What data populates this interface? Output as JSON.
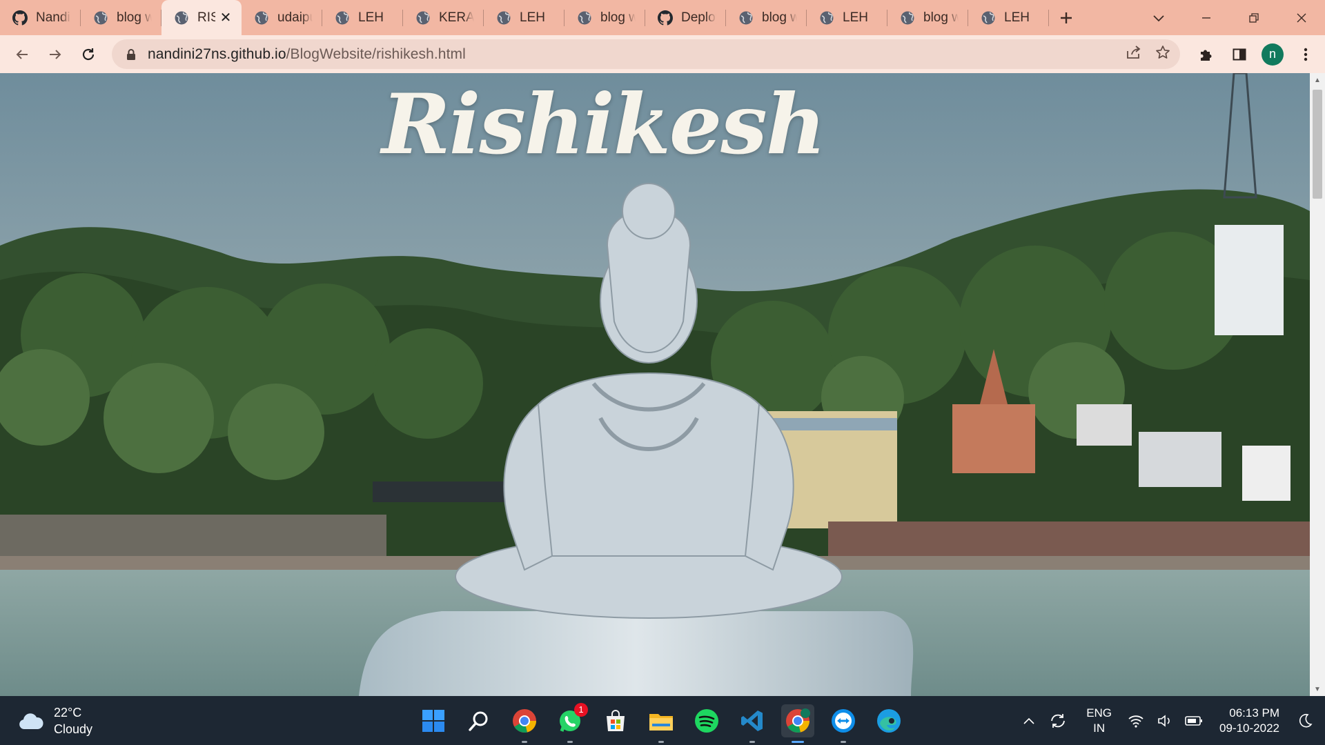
{
  "browser": {
    "tabs": [
      {
        "title": "Nandini",
        "favicon": "github-icon"
      },
      {
        "title": "blog w",
        "favicon": "globe-icon"
      },
      {
        "title": "RIS",
        "favicon": "globe-icon",
        "active": true
      },
      {
        "title": "udaipu",
        "favicon": "globe-icon"
      },
      {
        "title": "LEH",
        "favicon": "globe-icon"
      },
      {
        "title": "KERAL",
        "favicon": "globe-icon"
      },
      {
        "title": "LEH",
        "favicon": "globe-icon"
      },
      {
        "title": "blog w",
        "favicon": "globe-icon"
      },
      {
        "title": "Deploy",
        "favicon": "github-icon"
      },
      {
        "title": "blog w",
        "favicon": "globe-icon"
      },
      {
        "title": "LEH",
        "favicon": "globe-icon"
      },
      {
        "title": "blog w",
        "favicon": "globe-icon"
      },
      {
        "title": "LEH",
        "favicon": "globe-icon"
      }
    ],
    "address": {
      "host": "nandini27ns.github.io",
      "path": "/BlogWebsite/rishikesh.html"
    },
    "profile_initial": "n",
    "colors": {
      "tabstrip": "#f2b7a3",
      "toolbar": "#fbe7df",
      "omnibox": "#f0d7ce",
      "avatar": "#117a5d"
    }
  },
  "page": {
    "heading": "Rishikesh",
    "hero_image": "Shiva statue by the Ganges river in Rishikesh"
  },
  "taskbar": {
    "weather": {
      "temp": "22°C",
      "condition": "Cloudy"
    },
    "apps": [
      {
        "name": "start-button"
      },
      {
        "name": "search-button"
      },
      {
        "name": "chrome-app"
      },
      {
        "name": "whatsapp-app",
        "badge": "1"
      },
      {
        "name": "store-app"
      },
      {
        "name": "file-explorer-app"
      },
      {
        "name": "spotify-app"
      },
      {
        "name": "vscode-app"
      },
      {
        "name": "chrome-profile-app",
        "active": true
      },
      {
        "name": "teamviewer-app"
      },
      {
        "name": "edge-app"
      }
    ],
    "language": {
      "line1": "ENG",
      "line2": "IN"
    },
    "clock": {
      "time": "06:13 PM",
      "date": "09-10-2022"
    }
  }
}
